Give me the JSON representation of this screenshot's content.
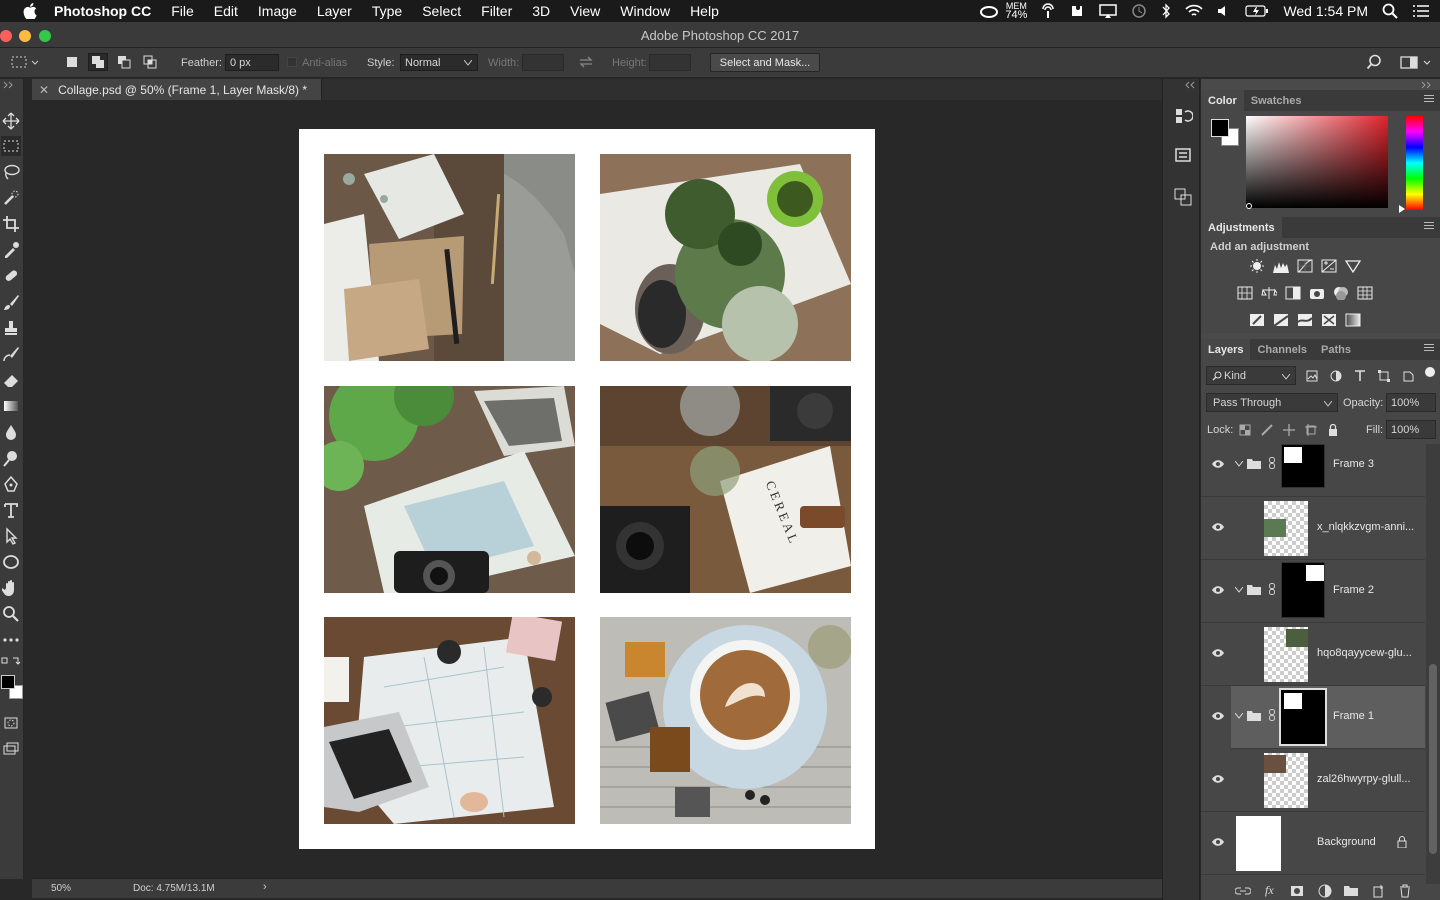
{
  "menubar": {
    "app_name": "Photoshop CC",
    "items": [
      "File",
      "Edit",
      "Image",
      "Layer",
      "Type",
      "Select",
      "Filter",
      "3D",
      "View",
      "Window",
      "Help"
    ],
    "mem_label": "MEM",
    "mem_value": "74%",
    "clock": "Wed 1:54 PM"
  },
  "window": {
    "title": "Adobe Photoshop CC 2017"
  },
  "options": {
    "feather_label": "Feather:",
    "feather_value": "0 px",
    "antialias_label": "Anti-alias",
    "style_label": "Style:",
    "style_value": "Normal",
    "width_label": "Width:",
    "height_label": "Height:",
    "select_mask_button": "Select and Mask..."
  },
  "document_tab": {
    "title": "Collage.psd @ 50% (Frame 1, Layer Mask/8) *"
  },
  "status": {
    "zoom": "50%",
    "doc_info": "Doc: 4.75M/13.1M"
  },
  "color_panel": {
    "tabs": [
      "Color",
      "Swatches"
    ]
  },
  "adjustments": {
    "title": "Adjustments",
    "subtitle": "Add an adjustment"
  },
  "layers_panel": {
    "tabs": [
      "Layers",
      "Channels",
      "Paths"
    ],
    "filter_kind": "Kind",
    "blend_mode": "Pass Through",
    "opacity_label": "Opacity:",
    "opacity_value": "100%",
    "lock_label": "Lock:",
    "fill_label": "Fill:",
    "fill_value": "100%",
    "layers": [
      {
        "name": "Frame 3"
      },
      {
        "name": "x_nlqkkzvgm-anni..."
      },
      {
        "name": "Frame 2"
      },
      {
        "name": "hqo8qayycew-glu..."
      },
      {
        "name": "Frame 1"
      },
      {
        "name": "zal26hwyrpy-glull..."
      },
      {
        "name": "Background"
      }
    ]
  },
  "colors": {
    "accent_selected_layer": "#5e5e5e",
    "panel_bg": "#4a4a4a"
  }
}
